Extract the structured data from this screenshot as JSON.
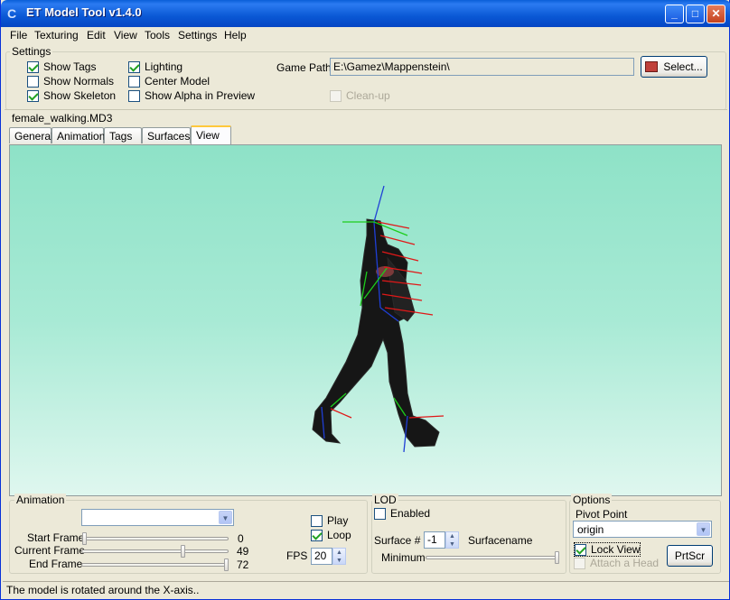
{
  "window": {
    "title": "ET Model Tool v1.4.0",
    "min": "_",
    "max": "□",
    "close": "✕"
  },
  "menu": [
    "File",
    "Texturing",
    "Edit",
    "View",
    "Tools",
    "Settings",
    "Help"
  ],
  "settings": {
    "legend": "Settings",
    "show_tags": {
      "label": "Show Tags",
      "checked": true
    },
    "show_normals": {
      "label": "Show Normals",
      "checked": false
    },
    "show_skeleton": {
      "label": "Show Skeleton",
      "checked": true
    },
    "lighting": {
      "label": "Lighting",
      "checked": true
    },
    "center_model": {
      "label": "Center Model",
      "checked": false
    },
    "show_alpha": {
      "label": "Show Alpha in Preview",
      "checked": false
    },
    "game_path_label": "Game Path",
    "game_path_value": "E:\\Gamez\\Mappenstein\\",
    "select_label": "Select...",
    "cleanup": {
      "label": "Clean-up",
      "checked": false
    }
  },
  "model_name": "female_walking.MD3",
  "tabs": [
    "General",
    "Animation",
    "Tags",
    "Surfaces",
    "View"
  ],
  "active_tab": "View",
  "animation": {
    "legend": "Animation",
    "combo_value": "",
    "start_label": "Start Frame",
    "start_value": "0",
    "current_label": "Current Frame",
    "current_value": "49",
    "end_label": "End Frame",
    "end_value": "72",
    "play": {
      "label": "Play",
      "checked": false
    },
    "loop": {
      "label": "Loop",
      "checked": true
    },
    "fps_label": "FPS",
    "fps_value": "20"
  },
  "lod": {
    "legend": "LOD",
    "enabled": {
      "label": "Enabled",
      "checked": false
    },
    "surface_label": "Surface #",
    "surface_value": "-1",
    "surfacename_label": "Surfacename",
    "minimum_label": "Minimum"
  },
  "options": {
    "legend": "Options",
    "pivot_label": "Pivot Point",
    "pivot_value": "origin",
    "lock_view": {
      "label": "Lock View",
      "checked": true
    },
    "attach_head": {
      "label": "Attach a Head",
      "checked": false
    },
    "prtscr_label": "PrtScr"
  },
  "status": "The model is rotated around the X-axis.."
}
